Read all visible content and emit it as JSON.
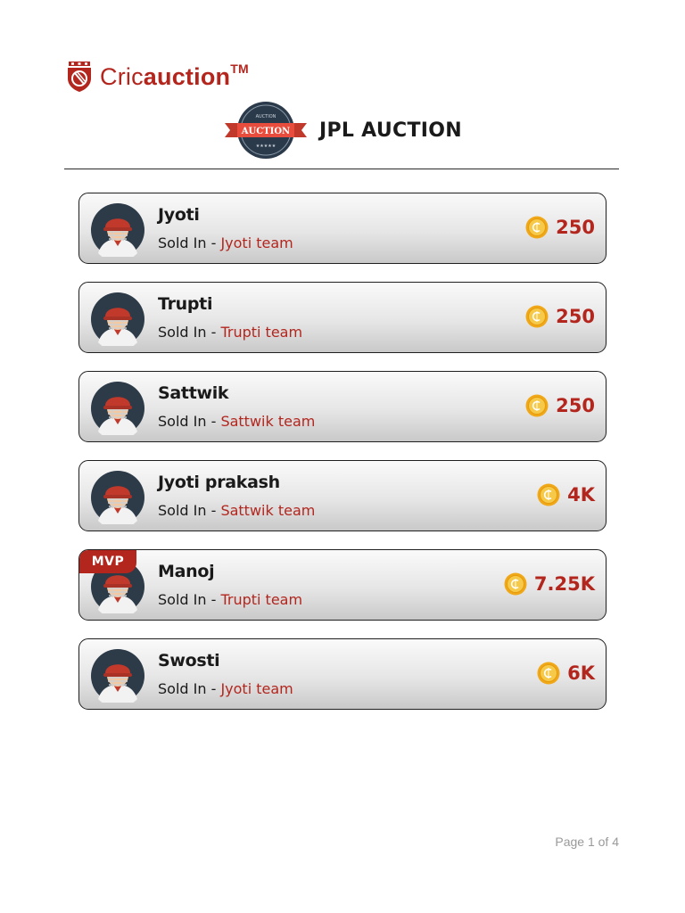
{
  "brand": {
    "prefix": "Cric",
    "suffix": "auction",
    "trademark": "TM",
    "color": "#b3261e"
  },
  "event": {
    "badge_label": "AUCTION",
    "badge_small_text": "AUCTION",
    "title": "JPL AUCTION"
  },
  "sold_prefix": "Sold In - ",
  "players": [
    {
      "name": "Jyoti",
      "team": "Jyoti team",
      "amount": "250",
      "mvp": false
    },
    {
      "name": "Trupti",
      "team": "Trupti team",
      "amount": "250",
      "mvp": false
    },
    {
      "name": "Sattwik",
      "team": "Sattwik team",
      "amount": "250",
      "mvp": false
    },
    {
      "name": "Jyoti prakash",
      "team": "Sattwik team",
      "amount": "4K",
      "mvp": false
    },
    {
      "name": "Manoj",
      "team": "Trupti team",
      "amount": "7.25K",
      "mvp": true,
      "badge": "MVP"
    },
    {
      "name": "Swosti",
      "team": "Jyoti team",
      "amount": "6K",
      "mvp": false
    }
  ],
  "icons": {
    "avatar": "cricket-player-avatar-icon",
    "coin": "coin-icon",
    "shield": "cricauction-shield-icon"
  },
  "footer": {
    "page_label": "Page 1 of 4"
  }
}
